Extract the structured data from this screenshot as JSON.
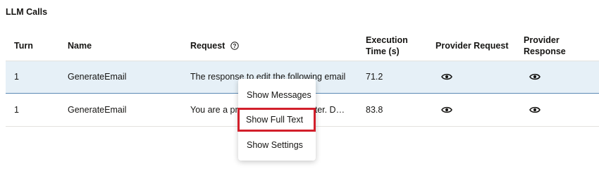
{
  "section_title": "LLM Calls",
  "columns": {
    "turn": "Turn",
    "name": "Name",
    "request": "Request",
    "exec_time_1": "Execution",
    "exec_time_2": "Time (s)",
    "provider_request": "Provider Request",
    "provider_response_1": "Provider",
    "provider_response_2": "Response"
  },
  "rows": [
    {
      "turn": "1",
      "name": "GenerateEmail",
      "request": "The response to edit the following email",
      "exec_time": "71.2",
      "selected": true
    },
    {
      "turn": "1",
      "name": "GenerateEmail",
      "request": "You are a professional email writer. Draft an email",
      "exec_time": "83.8",
      "selected": false
    }
  ],
  "context_menu": {
    "items": [
      "Show Messages",
      "Show Full Text",
      "Show Settings"
    ],
    "highlighted_index": 1
  },
  "colors": {
    "selected_row_bg": "#e6f0f7",
    "highlight_outline": "#d21f2b"
  },
  "icons": {
    "help": "help-circle-icon",
    "view": "eye-icon"
  }
}
